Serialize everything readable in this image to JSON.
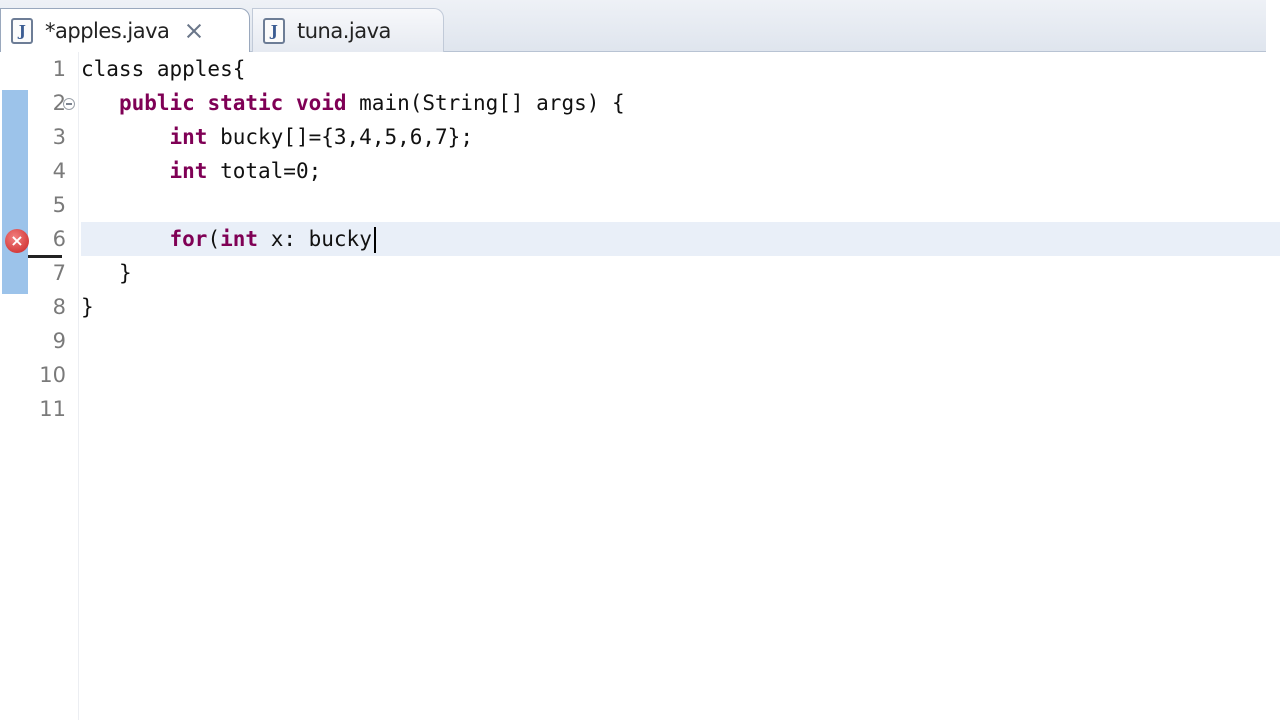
{
  "tabs": [
    {
      "label": "*apples.java",
      "icon": "java-file-icon",
      "active": true,
      "closable": true
    },
    {
      "label": "tuna.java",
      "icon": "java-file-icon",
      "active": false,
      "closable": false
    }
  ],
  "editor": {
    "line_numbers": [
      "1",
      "2",
      "3",
      "4",
      "5",
      "6",
      "7",
      "8",
      "9",
      "10",
      "11"
    ],
    "current_line": "6",
    "error_line": "6",
    "lines": [
      {
        "indent": "",
        "parts": [
          {
            "t": "class apples{"
          }
        ]
      },
      {
        "indent": "   ",
        "parts": [
          {
            "t": "public static void",
            "kw": true
          },
          {
            "t": " main(String[] args) {"
          }
        ]
      },
      {
        "indent": "       ",
        "parts": [
          {
            "t": "int",
            "kw": true
          },
          {
            "t": " bucky[]={3,4,5,6,7};"
          }
        ]
      },
      {
        "indent": "       ",
        "parts": [
          {
            "t": "int",
            "kw": true
          },
          {
            "t": " total=0;"
          }
        ]
      },
      {
        "indent": "",
        "parts": [
          {
            "t": ""
          }
        ]
      },
      {
        "indent": "       ",
        "parts": [
          {
            "t": "for",
            "kw": true
          },
          {
            "t": "("
          },
          {
            "t": "int",
            "kw": true
          },
          {
            "t": " x: bucky"
          }
        ]
      },
      {
        "indent": "   ",
        "parts": [
          {
            "t": "}"
          }
        ]
      },
      {
        "indent": "",
        "parts": [
          {
            "t": "}"
          }
        ]
      },
      {
        "indent": "",
        "parts": [
          {
            "t": ""
          }
        ]
      },
      {
        "indent": "",
        "parts": [
          {
            "t": ""
          }
        ]
      },
      {
        "indent": "",
        "parts": [
          {
            "t": ""
          }
        ]
      }
    ]
  },
  "colors": {
    "keyword": "#7f0055",
    "change_marker": "#9cc3ea",
    "current_line_bg": "#e9eff8",
    "error": "#c92222"
  }
}
